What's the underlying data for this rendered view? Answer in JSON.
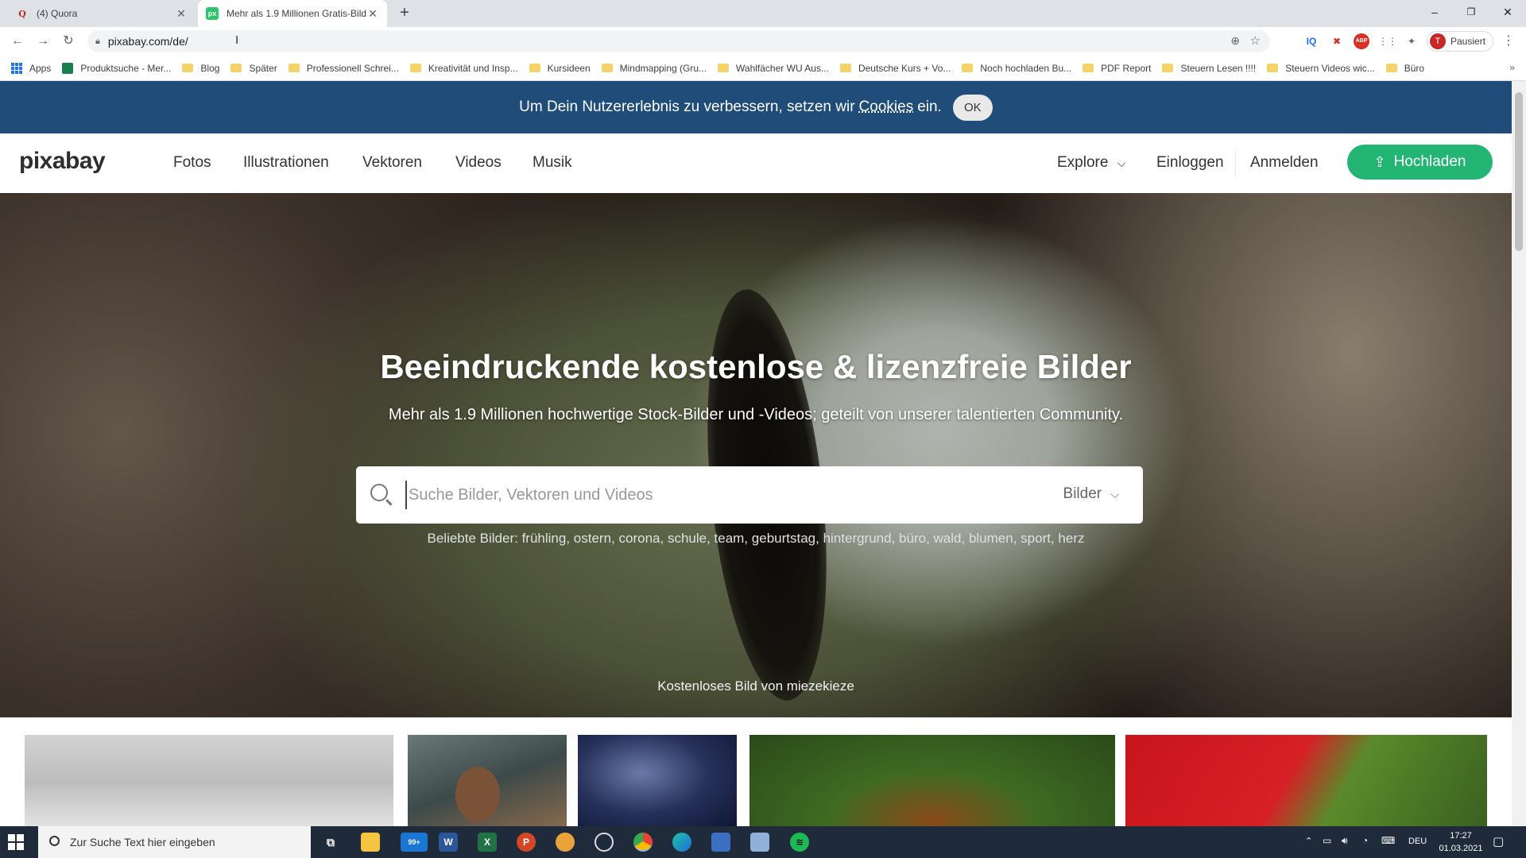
{
  "browser": {
    "tabs": [
      {
        "title": "(4) Quora",
        "favicon": "Q",
        "active": false
      },
      {
        "title": "Mehr als 1.9 Millionen Gratis-Bild",
        "favicon": "px",
        "active": true
      }
    ],
    "new_tab": "+",
    "window": {
      "minimize": "–",
      "maximize": "❐",
      "close": "✕"
    },
    "url": "pixabay.com/de/",
    "profile_label": "Pausiert",
    "profile_initial": "T",
    "bookmarks": [
      "Apps",
      "Produktsuche - Mer...",
      "Blog",
      "Später",
      "Professionell Schrei...",
      "Kreativität und Insp...",
      "Kursideen",
      "Mindmapping (Gru...",
      "Wahlfächer WU Aus...",
      "Deutsche Kurs + Vo...",
      "Noch hochladen Bu...",
      "PDF Report",
      "Steuern Lesen !!!!",
      "Steuern Videos wic...",
      "Büro"
    ],
    "bookmarks_more": "»"
  },
  "cookie": {
    "text_before": "Um Dein Nutzererlebnis zu verbessern, setzen wir",
    "link": "Cookies",
    "text_after": "ein.",
    "ok": "OK"
  },
  "nav": {
    "logo": "pixabay",
    "links": [
      "Fotos",
      "Illustrationen",
      "Vektoren",
      "Videos",
      "Musik"
    ],
    "explore": "Explore",
    "login": "Einloggen",
    "register": "Anmelden",
    "upload": "Hochladen"
  },
  "hero": {
    "title": "Beeindruckende kostenlose & lizenzfreie Bilder",
    "subtitle": "Mehr als 1.9 Millionen hochwertige Stock-Bilder und -Videos; geteilt von unserer talentierten Community.",
    "search_placeholder": "Suche Bilder, Vektoren und Videos",
    "search_type": "Bilder",
    "popular_label": "Beliebte Bilder:",
    "popular_tags": [
      "frühling",
      "ostern",
      "corona",
      "schule",
      "team",
      "geburtstag",
      "hintergrund",
      "büro",
      "wald",
      "blumen",
      "sport",
      "herz"
    ],
    "credit": "Kostenloses Bild von miezekieze"
  },
  "taskbar": {
    "search_placeholder": "Zur Suche Text hier eingeben",
    "mail_badge": "99+",
    "lang": "DEU",
    "time": "17:27",
    "date": "01.03.2021"
  },
  "colors": {
    "cookie_bar": "#1f4c79",
    "upload_button": "#22b573",
    "taskbar": "#1f2a3a"
  }
}
